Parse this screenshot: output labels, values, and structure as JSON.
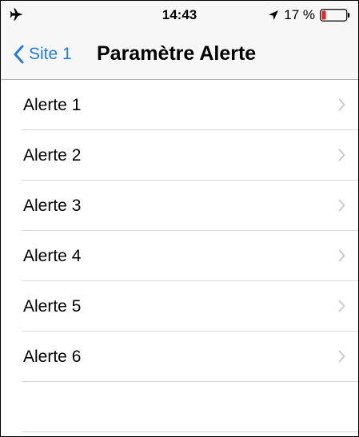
{
  "status_bar": {
    "time": "14:43",
    "battery_percent": "17 %",
    "battery_level": 0.17,
    "icons": [
      "airplane-icon",
      "location-arrow-icon",
      "battery-icon"
    ]
  },
  "nav": {
    "back_label": "Site 1",
    "title": "Paramètre Alerte"
  },
  "alerts": [
    {
      "label": "Alerte 1"
    },
    {
      "label": "Alerte 2"
    },
    {
      "label": "Alerte 3"
    },
    {
      "label": "Alerte 4"
    },
    {
      "label": "Alerte 5"
    },
    {
      "label": "Alerte 6"
    }
  ],
  "colors": {
    "accent": "#1f7ce8",
    "battery_low": "#e8211b",
    "separator": "#d8d8dc",
    "chevron": "#c7c7cc"
  }
}
